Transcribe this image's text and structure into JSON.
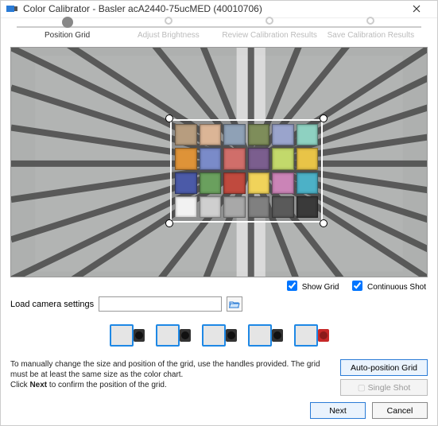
{
  "window": {
    "title": "Color Calibrator - Basler acA2440-75ucMED (40010706)"
  },
  "stepper": {
    "steps": [
      {
        "label": "Position Grid",
        "active": true
      },
      {
        "label": "Adjust Brightness",
        "active": false
      },
      {
        "label": "Review Calibration Results",
        "active": false
      },
      {
        "label": "Save Calibration Results",
        "active": false
      }
    ]
  },
  "preview_options": {
    "show_grid": {
      "label": "Show Grid",
      "checked": true
    },
    "continuous_shot": {
      "label": "Continuous Shot",
      "checked": true
    }
  },
  "load_settings": {
    "label": "Load camera settings",
    "value": ""
  },
  "color_patches": [
    "#b79d7f",
    "#dbb596",
    "#8fa1b6",
    "#7e8d5a",
    "#9aa4cc",
    "#8ed1c1",
    "#de9338",
    "#7a8bc9",
    "#d06e6a",
    "#7b5e8e",
    "#c2d96b",
    "#e9c447",
    "#4b5aa8",
    "#6aa05e",
    "#c04a3e",
    "#f0d35a",
    "#cb84b7",
    "#4cb1c7",
    "#f2f2f2",
    "#cfcfcf",
    "#a8a8a8",
    "#808080",
    "#5a5a5a",
    "#3a3a3a"
  ],
  "instructions": {
    "line1": "To manually change the size and position of the grid, use the handles provided. The grid must be at least the same size as the color chart.",
    "line2_prefix": "Click ",
    "line2_bold": "Next",
    "line2_suffix": " to confirm the position of the grid."
  },
  "buttons": {
    "auto_position": "Auto-position Grid",
    "single_shot": "Single Shot",
    "next": "Next",
    "cancel": "Cancel"
  }
}
